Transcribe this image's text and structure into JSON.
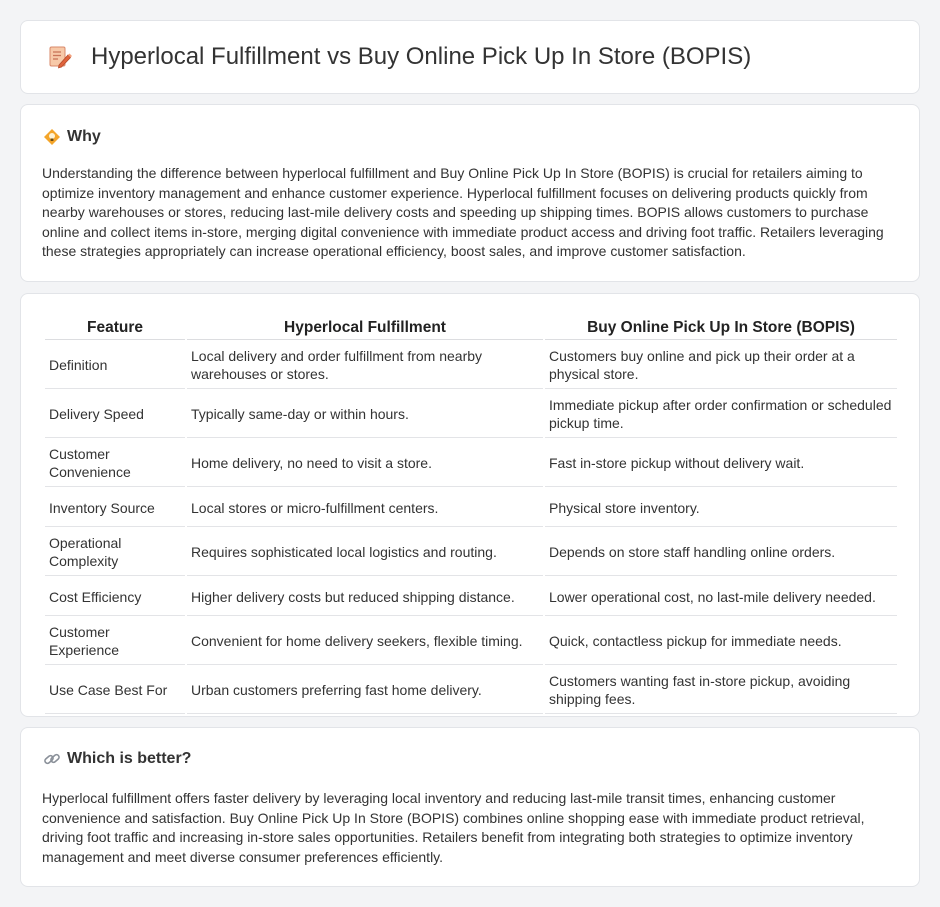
{
  "header": {
    "title": "Hyperlocal Fulfillment vs Buy Online Pick Up In Store (BOPIS)",
    "icon": "document-pen-icon"
  },
  "why": {
    "title": "Why",
    "icon": "lightbulb-diamond-icon",
    "text": "Understanding the difference between hyperlocal fulfillment and Buy Online Pick Up In Store (BOPIS) is crucial for retailers aiming to optimize inventory management and enhance customer experience. Hyperlocal fulfillment focuses on delivering products quickly from nearby warehouses or stores, reducing last-mile delivery costs and speeding up shipping times. BOPIS allows customers to purchase online and collect items in-store, merging digital convenience with immediate product access and driving foot traffic. Retailers leveraging these strategies appropriately can increase operational efficiency, boost sales, and improve customer satisfaction."
  },
  "table": {
    "headers": [
      "Feature",
      "Hyperlocal Fulfillment",
      "Buy Online Pick Up In Store (BOPIS)"
    ],
    "rows": [
      [
        "Definition",
        "Local delivery and order fulfillment from nearby warehouses or stores.",
        "Customers buy online and pick up their order at a physical store."
      ],
      [
        "Delivery Speed",
        "Typically same-day or within hours.",
        "Immediate pickup after order confirmation or scheduled pickup time."
      ],
      [
        "Customer Convenience",
        "Home delivery, no need to visit a store.",
        "Fast in-store pickup without delivery wait."
      ],
      [
        "Inventory Source",
        "Local stores or micro-fulfillment centers.",
        "Physical store inventory."
      ],
      [
        "Operational Complexity",
        "Requires sophisticated local logistics and routing.",
        "Depends on store staff handling online orders."
      ],
      [
        "Cost Efficiency",
        "Higher delivery costs but reduced shipping distance.",
        "Lower operational cost, no last-mile delivery needed."
      ],
      [
        "Customer Experience",
        "Convenient for home delivery seekers, flexible timing.",
        "Quick, contactless pickup for immediate needs."
      ],
      [
        "Use Case Best For",
        "Urban customers preferring fast home delivery.",
        "Customers wanting fast in-store pickup, avoiding shipping fees."
      ]
    ]
  },
  "better": {
    "title": "Which is better?",
    "icon": "link-icon",
    "text": "Hyperlocal fulfillment offers faster delivery by leveraging local inventory and reducing last-mile transit times, enhancing customer convenience and satisfaction. Buy Online Pick Up In Store (BOPIS) combines online shopping ease with immediate product retrieval, driving foot traffic and increasing in-store sales opportunities. Retailers benefit from integrating both strategies to optimize inventory management and meet diverse consumer preferences efficiently."
  }
}
